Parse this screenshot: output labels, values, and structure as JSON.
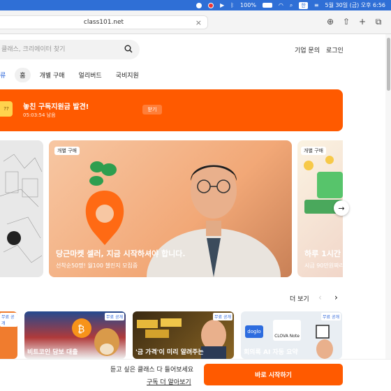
{
  "menubar": {
    "battery": "100%",
    "input_source": "한",
    "datetime": "5월 30일 (금) 오후 6:56"
  },
  "browser": {
    "url": "class101.net"
  },
  "header": {
    "search_placeholder": "클래스, 크리에이터 찾기",
    "company_inquiry": "기업 문의",
    "login": "로그인"
  },
  "tabs": [
    {
      "label": "류"
    },
    {
      "label": "홈"
    },
    {
      "label": "개별 구매"
    },
    {
      "label": "얼리버드"
    },
    {
      "label": "국비지원"
    }
  ],
  "banner": {
    "coin_text": "??",
    "title": "놓친 구독지원금 발견!",
    "subtitle": "05:03:54 남음",
    "button": "받기"
  },
  "carousel": {
    "main": {
      "chip": "개별 구매",
      "title": "당근마켓 셀러, 지금 시작하셔야 합니다.",
      "subtitle": "선착순50명! 월100 챌린지 모집중"
    },
    "right": {
      "chip": "개별 구매",
      "title": "하루 1시간",
      "subtitle": "시급 90만원짜리"
    }
  },
  "section": {
    "more": "더 보기"
  },
  "thumbnails": [
    {
      "badge": "무료 공개",
      "text": ""
    },
    {
      "badge": "무료 공개",
      "text": "비트코인 담보 대출"
    },
    {
      "badge": "무료 공개",
      "text": "'금 가격'이 미리 알려주는"
    },
    {
      "badge": "무료 공개",
      "text": "회의록 AI 자동 요약"
    }
  ],
  "thumb_labels": {
    "dogio": "doglo",
    "clova": "CLOVA Note"
  },
  "cta": {
    "text": "듣고 싶은 클래스 다 들어보세요",
    "link": "구독 더 알아보기",
    "button": "바로 시작하기"
  },
  "colors": {
    "accent": "#ff5a00",
    "menubar": "#2f6fd6",
    "link_blue": "#2a64d9"
  }
}
